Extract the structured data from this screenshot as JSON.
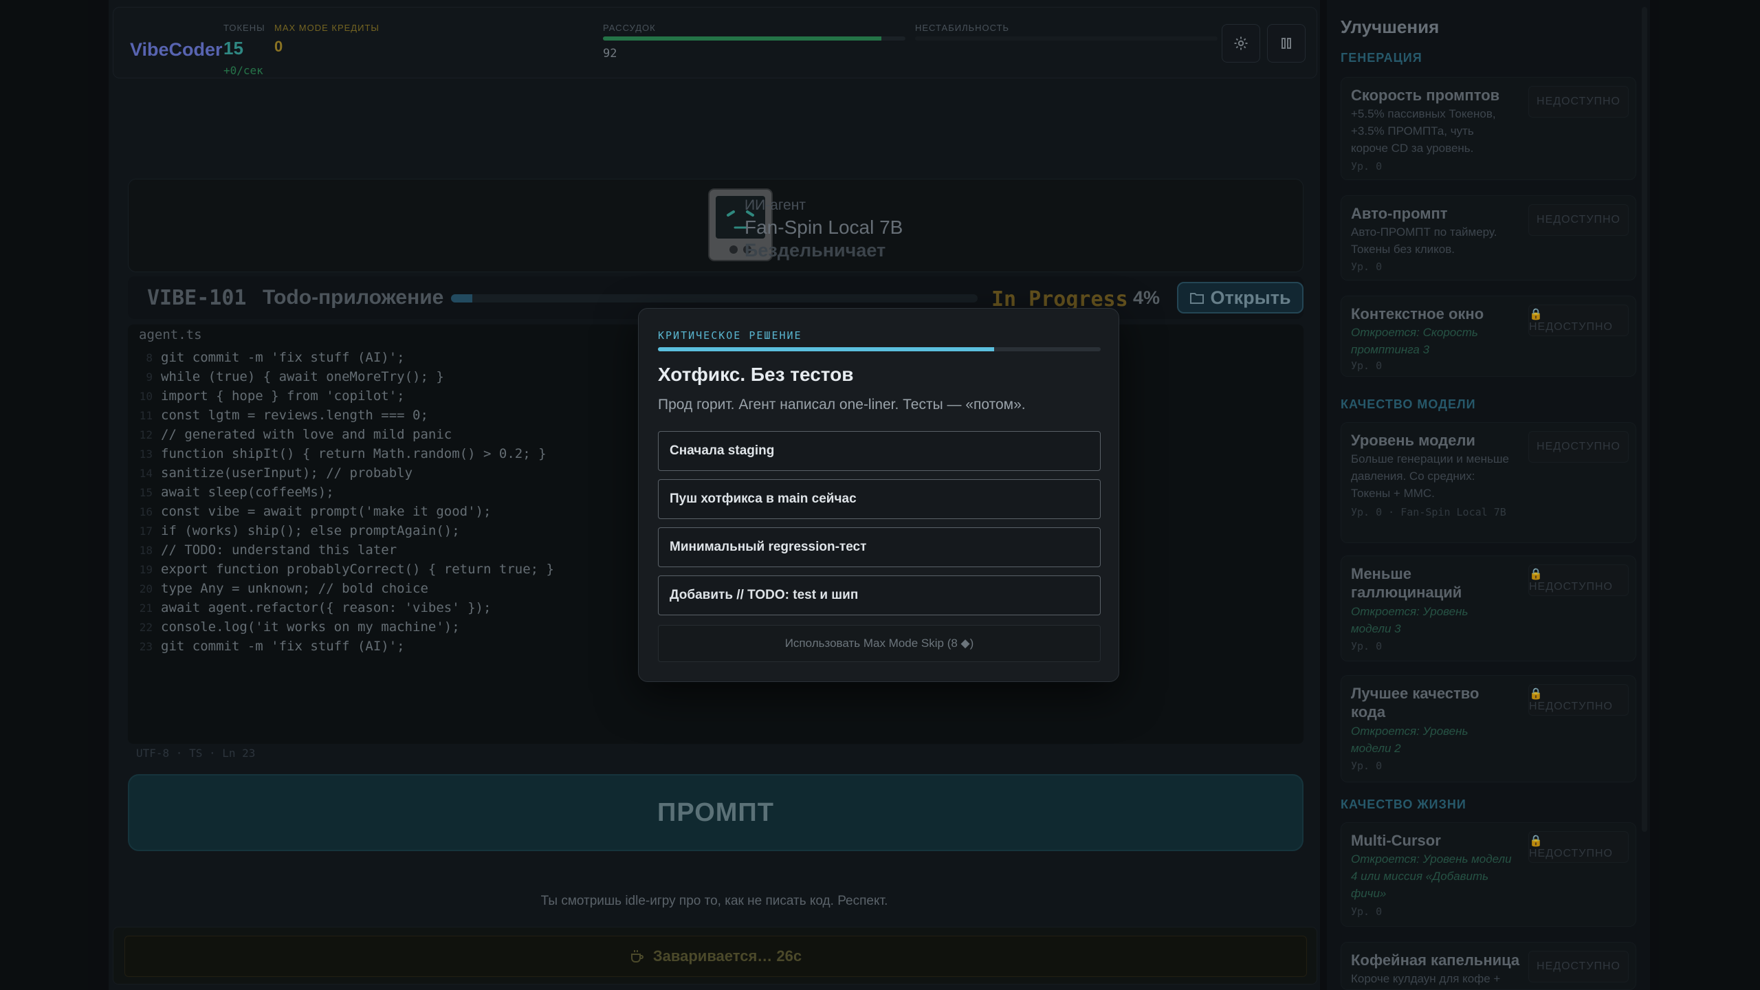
{
  "header": {
    "logo": "VibeCoder",
    "tokens_label": "ТОКЕНЫ",
    "tokens_value": "15",
    "tokens_rate": "+0/сек",
    "maxmode_label": "MAX MODE КРЕДИТЫ",
    "maxmode_value": "0",
    "sanity_label": "РАССУДОК",
    "sanity_value": "92",
    "sanity_fraction": 0.92,
    "instability_label": "НЕСТАБИЛЬНОСТЬ",
    "instability_fraction": 0.0
  },
  "agent": {
    "role": "ИИ-агент",
    "name": "Fan-Spin Local 7B",
    "status": "Бездельничает"
  },
  "task": {
    "id": "VIBE-101",
    "name": "Todo-приложение",
    "state": "In Progress",
    "percent": "4%",
    "progress_fraction": 0.04,
    "open_label": "Открыть"
  },
  "editor": {
    "tab": "agent.ts",
    "lines": [
      {
        "n": "8",
        "code": "git commit -m 'fix stuff (AI)';"
      },
      {
        "n": "9",
        "code": "while (true) { await oneMoreTry(); }"
      },
      {
        "n": "10",
        "code": "import { hope } from 'copilot';"
      },
      {
        "n": "11",
        "code": "const lgtm = reviews.length === 0;"
      },
      {
        "n": "12",
        "code": "// generated with love and mild panic"
      },
      {
        "n": "13",
        "code": "function shipIt() { return Math.random() > 0.2; }"
      },
      {
        "n": "14",
        "code": "sanitize(userInput); // probably"
      },
      {
        "n": "15",
        "code": "await sleep(coffeeMs);"
      },
      {
        "n": "16",
        "code": "const vibe = await prompt('make it good');"
      },
      {
        "n": "17",
        "code": "if (works) ship(); else promptAgain();"
      },
      {
        "n": "18",
        "code": "// TODO: understand this later"
      },
      {
        "n": "19",
        "code": "export function probablyCorrect() { return true; }"
      },
      {
        "n": "20",
        "code": "type Any = unknown; // bold choice"
      },
      {
        "n": "21",
        "code": "await agent.refactor({ reason: 'vibes' });"
      },
      {
        "n": "22",
        "code": "console.log('it works on my machine');"
      },
      {
        "n": "23",
        "code": "git commit -m 'fix stuff (AI)';"
      }
    ],
    "status_line": "UTF-8 · TS · Ln 23"
  },
  "prompt_button": "ПРОМПТ",
  "flavor_text": "Ты смотришь idle-игру про то, как не писать код. Респект.",
  "coffee": {
    "label": "Заваривается… 26с"
  },
  "sidebar": {
    "title": "Улучшения",
    "sections": [
      {
        "title": "ГЕНЕРАЦИЯ"
      },
      {
        "title": "КАЧЕСТВО МОДЕЛИ"
      },
      {
        "title": "КАЧЕСТВО ЖИЗНИ"
      }
    ],
    "upgrades": [
      {
        "name": "Скорость промптов",
        "desc": "+5.5% пассивных Токенов, +3.5% ПРОМПТа, чуть короче CD за уровень.",
        "locked": false,
        "level": "Ур. 0",
        "button": "НЕДОСТУПНО"
      },
      {
        "name": "Авто-промпт",
        "desc": "Авто-ПРОМПТ по таймеру. Токены без кликов.",
        "locked": false,
        "level": "Ур. 0",
        "button": "НЕДОСТУПНО"
      },
      {
        "name": "Контекстное окно",
        "desc": "Откроется: Скорость промптинга 3",
        "locked": true,
        "level": "Ур. 0",
        "button": "🔒 НЕДОСТУПНО"
      },
      {
        "name": "Уровень модели",
        "desc": "Больше генерации и меньше давления. Со средних: Токены + ММС.",
        "locked": false,
        "level": "Ур. 0 · Fan-Spin Local 7B",
        "button": "НЕДОСТУПНО"
      },
      {
        "name": "Меньше галлюцинаций",
        "desc": "Откроется: Уровень модели 3",
        "locked": true,
        "level": "Ур. 0",
        "button": "🔒 НЕДОСТУПНО"
      },
      {
        "name": "Лучшее качество кода",
        "desc": "Откроется: Уровень модели 2",
        "locked": true,
        "level": "Ур. 0",
        "button": "🔒 НЕДОСТУПНО"
      },
      {
        "name": "Multi-Cursor",
        "desc": "Откроется: Уровень модели 4 или миссия «Добавить фичи»",
        "locked": true,
        "level": "Ур. 0",
        "button": "🔒 НЕДОСТУПНО"
      },
      {
        "name": "Кофейная капельница",
        "desc": "Короче кулдаун для кофе +",
        "locked": false,
        "level": "",
        "button": "НЕДОСТУПНО"
      }
    ]
  },
  "modal": {
    "label": "КРИТИЧЕСКОЕ РЕШЕНИЕ",
    "timer_fraction": 0.76,
    "title": "Хотфикс. Без тестов",
    "description": "Прод горит. Агент написал one-liner. Тесты — «потом».",
    "choices": [
      "Сначала staging",
      "Пуш хотфикса в main сейчас",
      "Минимальный regression-тест",
      "Добавить // TODO: test и шип"
    ],
    "skip_label": "Использовать Max Mode Skip (8 ◆)"
  },
  "icons": {
    "settings": "gear-icon",
    "pause": "pause-icon",
    "open": "folder-icon",
    "coffee": "coffee-icon",
    "lock": "lock-icon"
  },
  "colors": {
    "accent": "#5bc0de",
    "logo": "#6c7bd8",
    "tokens": "#3aa7a0",
    "maxmode": "#a98d2b",
    "sanity": "#2d8d57"
  }
}
